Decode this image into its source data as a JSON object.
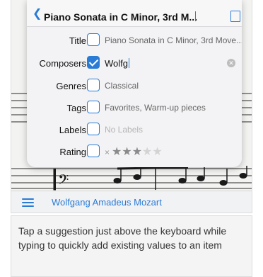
{
  "header": {
    "title": "Piano Sonata in C Minor, 3rd M..."
  },
  "fields": [
    {
      "label": "Title",
      "checked": false,
      "value": "Piano Sonata in C Minor, 3rd Move...",
      "style": "value"
    },
    {
      "label": "Composers",
      "checked": true,
      "value": "Wolfg",
      "style": "typed"
    },
    {
      "label": "Genres",
      "checked": false,
      "value": "Classical",
      "style": "value"
    },
    {
      "label": "Tags",
      "checked": false,
      "value": "Favorites, Warm-up pieces",
      "style": "value"
    },
    {
      "label": "Labels",
      "checked": false,
      "value": "No Labels",
      "style": "placeholder"
    },
    {
      "label": "Rating",
      "checked": false,
      "value": "",
      "style": "rating"
    }
  ],
  "rating": {
    "value": 3,
    "max": 5,
    "clear_glyph": "×"
  },
  "toolbar": {
    "title": "Wolfgang Amadeus Mozart",
    "menu_icon": "hamburger-menu-icon"
  },
  "caption": "Tap a suggestion just above the keyboard while typing to quickly add existing values to an item",
  "colors": {
    "accent": "#2a7bd6",
    "text": "#111111",
    "muted": "#666666",
    "placeholder": "#b5b5b5"
  }
}
